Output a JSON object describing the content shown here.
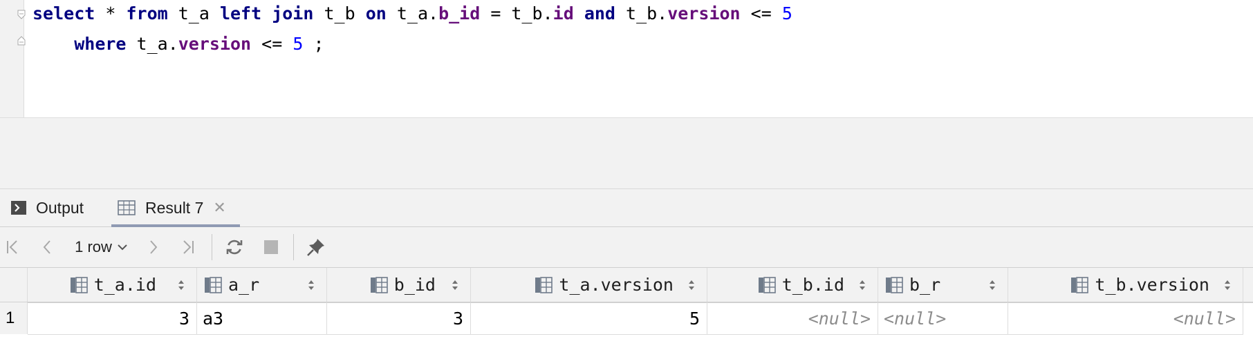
{
  "editor": {
    "line1": {
      "t1": "select",
      "t2": " * ",
      "t3": "from",
      "t4": " t_a ",
      "t5": "left join",
      "t6": " t_b ",
      "t7": "on",
      "t8": " t_a.",
      "t9": "b_id",
      "t10": " = t_b.",
      "t11": "id",
      "t12": " ",
      "t13": "and",
      "t14": " t_b.",
      "t15": "version",
      "t16": " <= ",
      "t17": "5"
    },
    "line2": {
      "t1": "    ",
      "t2": "where",
      "t3": " t_a.",
      "t4": "version",
      "t5": " <= ",
      "t6": "5",
      "t7": " ;"
    }
  },
  "tabs": [
    {
      "label": "Output",
      "icon": "console-icon"
    },
    {
      "label": "Result 7",
      "icon": "table-icon",
      "close": "✕"
    }
  ],
  "toolbar": {
    "row_count": "1 row",
    "buttons": [
      "first-page-icon",
      "previous-page-icon",
      "next-page-icon",
      "last-page-icon",
      "refresh-icon",
      "stop-icon",
      "pin-icon"
    ]
  },
  "grid": {
    "columns": [
      "t_a.id",
      "a_r",
      "b_id",
      "t_a.version",
      "t_b.id",
      "b_r",
      "t_b.version"
    ],
    "rows": [
      {
        "num": "1",
        "values": [
          "3",
          "a3",
          "3",
          "5",
          "<null>",
          "<null>",
          "<null>"
        ]
      }
    ]
  },
  "colors": {
    "keyword": "#000080",
    "field": "#660e7a",
    "number": "#0000ff",
    "null_text": "#8c8c8c",
    "tab_underline": "#8f9ab3"
  }
}
